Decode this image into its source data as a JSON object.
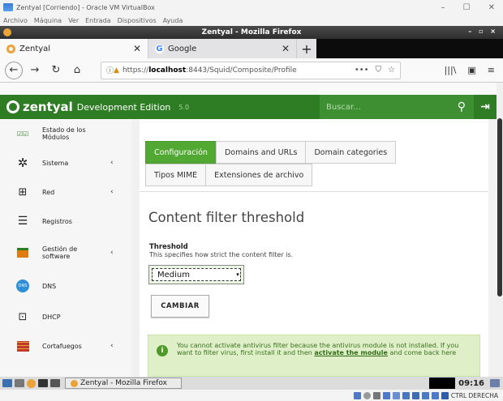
{
  "vbox": {
    "title": "Zentyal [Corriendo] - Oracle VM VirtualBox",
    "menu": [
      "Archivo",
      "Máquina",
      "Ver",
      "Entrada",
      "Dispositivos",
      "Ayuda"
    ],
    "host_key": "CTRL DERECHA"
  },
  "firefox": {
    "window_title": "Zentyal - Mozilla Firefox",
    "tabs": [
      {
        "label": "Zentyal",
        "icon": "zentyal-favicon"
      },
      {
        "label": "Google",
        "icon": "google-favicon"
      }
    ],
    "url_prefix": "https://",
    "url_host": "localhost",
    "url_path": ":8443/Squid/Composite/Profile"
  },
  "zentyal": {
    "brand": "zentyal",
    "edition": "Development Edition",
    "version": "5.0",
    "search_placeholder": "Buscar..."
  },
  "sidebar": {
    "items": [
      {
        "label": "Estado de los Módulos",
        "icon": "dashboard-icon",
        "arrow": ""
      },
      {
        "label": "Sistema",
        "icon": "gear-icon",
        "arrow": "‹"
      },
      {
        "label": "Red",
        "icon": "network-icon",
        "arrow": "‹"
      },
      {
        "label": "Registros",
        "icon": "logs-icon",
        "arrow": ""
      },
      {
        "label": "Gestión de software",
        "icon": "package-icon",
        "arrow": "‹"
      },
      {
        "label": "DNS",
        "icon": "dns-icon",
        "arrow": ""
      },
      {
        "label": "DHCP",
        "icon": "dhcp-icon",
        "arrow": ""
      },
      {
        "label": "Cortafuegos",
        "icon": "firewall-icon",
        "arrow": "‹"
      }
    ]
  },
  "main": {
    "tabs": [
      "Configuración",
      "Domains and URLs",
      "Domain categories"
    ],
    "tabs2": [
      "Tipos MIME",
      "Extensiones de archivo"
    ],
    "heading": "Content filter threshold",
    "field_label": "Threshold",
    "field_hint": "This specifies how strict the content filter is.",
    "select_value": "Medium",
    "submit_label": "CAMBIAR",
    "alert_text": "You cannot activate antivirus filter because the antivirus module is not installed. If you want to filter virus, first install it and then ",
    "alert_link": "activate the module",
    "alert_tail": " and come back here"
  },
  "taskbar": {
    "window_label": "Zentyal - Mozilla Firefox",
    "clock": "09:16"
  },
  "colors": {
    "accent": "#51a832",
    "header": "#2e7d24",
    "alert_bg": "#dff0c9"
  }
}
